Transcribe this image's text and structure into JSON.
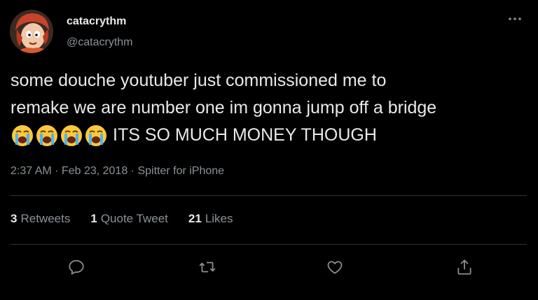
{
  "user": {
    "display_name": "catacrythm",
    "handle": "@catacrythm",
    "avatar_icon": "cartoon-avatar"
  },
  "more_icon": "more-icon",
  "tweet": {
    "line1": "some douche youtuber just commissioned me to",
    "line2": "remake we are number one im gonna jump off a bridge",
    "emoji": [
      "😭",
      "😭",
      "😭",
      "😭"
    ],
    "line3_text": "ITS SO MUCH MONEY THOUGH"
  },
  "meta": {
    "time": "2:37 AM",
    "separator1": " · ",
    "date": "Feb 23, 2018",
    "separator2": " · ",
    "source": "Spitter for iPhone"
  },
  "stats": [
    {
      "count": "3",
      "label": "Retweets"
    },
    {
      "count": "1",
      "label": "Quote Tweet"
    },
    {
      "count": "21",
      "label": "Likes"
    }
  ],
  "actions": [
    {
      "name": "reply-icon"
    },
    {
      "name": "retweet-icon"
    },
    {
      "name": "like-icon"
    },
    {
      "name": "share-icon"
    }
  ],
  "colors": {
    "background": "#000000",
    "text": "#e7e9ea",
    "muted": "#8b9298",
    "divider": "#2f3336"
  }
}
